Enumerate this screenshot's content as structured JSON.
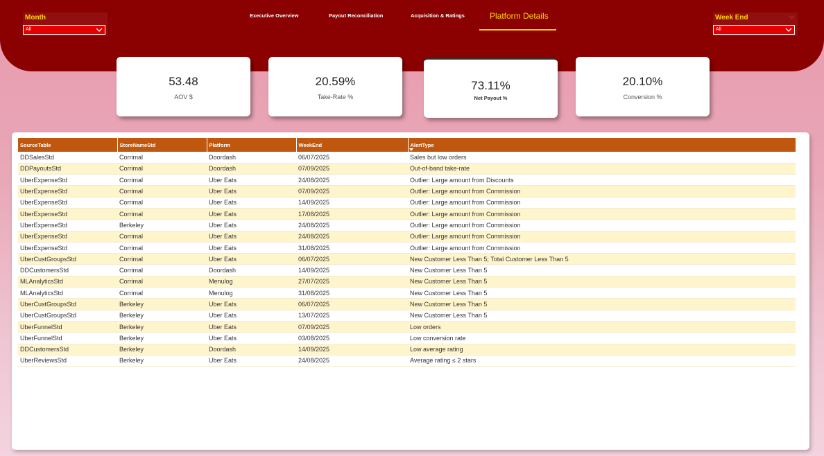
{
  "filters": {
    "month": {
      "label": "Month",
      "value": "All"
    },
    "week_end": {
      "label": "Week End",
      "value": "All"
    }
  },
  "nav": {
    "tabs": [
      {
        "label": "Executive Overview"
      },
      {
        "label": "Payout Reconciliation"
      },
      {
        "label": "Acquisition & Ratings"
      },
      {
        "label": "Platform Details"
      }
    ],
    "active_tab": "Platform Details"
  },
  "kpis": [
    {
      "value": "53.48",
      "label": "AOV $"
    },
    {
      "value": "20.59%",
      "label": "Take-Rate %"
    },
    {
      "value": "73.11%",
      "label": "Net Payout %"
    },
    {
      "value": "20.10%",
      "label": "Conversion %"
    }
  ],
  "table": {
    "columns": [
      "SourceTable",
      "StoreNameStd",
      "Platform",
      "WeekEnd",
      "AlertType"
    ],
    "rows": [
      [
        "DDSalesStd",
        "Corrimal",
        "Doordash",
        "06/07/2025",
        "Sales but low orders"
      ],
      [
        "DDPayoutsStd",
        "Corrimal",
        "Doordash",
        "07/09/2025",
        "Out-of-band take-rate"
      ],
      [
        "UberExpenseStd",
        "Corrimal",
        "Uber Eats",
        "24/08/2025",
        "Outlier: Large amount from Discounts"
      ],
      [
        "UberExpenseStd",
        "Corrimal",
        "Uber Eats",
        "07/09/2025",
        "Outlier: Large amount from Commission"
      ],
      [
        "UberExpenseStd",
        "Corrimal",
        "Uber Eats",
        "14/09/2025",
        "Outlier: Large amount from Commission"
      ],
      [
        "UberExpenseStd",
        "Corrimal",
        "Uber Eats",
        "17/08/2025",
        "Outlier: Large amount from Commission"
      ],
      [
        "UberExpenseStd",
        "Berkeley",
        "Uber Eats",
        "24/08/2025",
        "Outlier: Large amount from Commission"
      ],
      [
        "UberExpenseStd",
        "Corrimal",
        "Uber Eats",
        "24/08/2025",
        "Outlier: Large amount from Commission"
      ],
      [
        "UberExpenseStd",
        "Corrimal",
        "Uber Eats",
        "31/08/2025",
        "Outlier: Large amount from Commission"
      ],
      [
        "UberCustGroupsStd",
        "Corrimal",
        "Uber Eats",
        "06/07/2025",
        "New Customer Less Than 5; Total Customer Less Than 5"
      ],
      [
        "DDCustomersStd",
        "Corrimal",
        "Doordash",
        "14/09/2025",
        "New Customer Less Than 5"
      ],
      [
        "MLAnalyticsStd",
        "Corrimal",
        "Menulog",
        "27/07/2025",
        "New Customer Less Than 5"
      ],
      [
        "MLAnalyticsStd",
        "Corrimal",
        "Menulog",
        "31/08/2025",
        "New Customer Less Than 5"
      ],
      [
        "UberCustGroupsStd",
        "Berkeley",
        "Uber Eats",
        "06/07/2025",
        "New Customer Less Than 5"
      ],
      [
        "UberCustGroupsStd",
        "Berkeley",
        "Uber Eats",
        "13/07/2025",
        "New Customer Less Than 5"
      ],
      [
        "UberFunnelStd",
        "Berkeley",
        "Uber Eats",
        "07/09/2025",
        "Low orders"
      ],
      [
        "UberFunnelStd",
        "Berkeley",
        "Uber Eats",
        "03/08/2025",
        "Low conversion rate"
      ],
      [
        "DDCustomersStd",
        "Berkeley",
        "Doordash",
        "14/09/2025",
        "Low average rating"
      ],
      [
        "UberReviewsStd",
        "Berkeley",
        "Uber Eats",
        "24/08/2025",
        "Average rating ≤ 2 stars"
      ]
    ]
  },
  "colors": {
    "header_bg": "#8b0000",
    "accent_yellow": "#ffd400",
    "table_header": "#c0570f",
    "row_alt": "#fff5cc",
    "select_bg": "#e50000"
  }
}
